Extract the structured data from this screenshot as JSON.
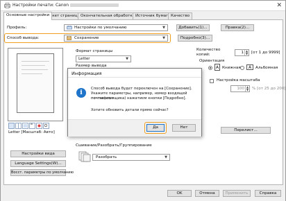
{
  "window": {
    "title": "Настройки печати: Canon",
    "close_glyph": "✕"
  },
  "tabs": [
    {
      "label": "Основные настройки",
      "active": true
    },
    {
      "label": "Макет страницы",
      "active": false
    },
    {
      "label": "Окончательная обработка",
      "active": false
    },
    {
      "label": "Источник бумаги",
      "active": false
    },
    {
      "label": "Качество",
      "active": false
    }
  ],
  "profile": {
    "label": "Профиль:",
    "value": "Настройки по умолчанию",
    "add_button": "Добавить(1)...",
    "edit_button": "Правка(2)..."
  },
  "output": {
    "label": "Способ вывода:",
    "value": "Сохранение",
    "details_button": "Подробно(3)...",
    "highlight_color": "#f0a020"
  },
  "page_format": {
    "label": "Формат страницы",
    "value": "Letter"
  },
  "output_size": {
    "label": "Размер вывода"
  },
  "copies": {
    "label_line1": "Количество",
    "label_line2": "копий:",
    "value": "1",
    "range": "[от 1 до 9999]"
  },
  "orientation": {
    "label": "Ориентация",
    "portrait_letter": "A",
    "portrait": "Книжная",
    "landscape_letter": "A",
    "landscape": "Альбомная"
  },
  "scaling": {
    "label": "Настройка масштаба",
    "value": "100",
    "range": "% [от 25 до 200]"
  },
  "preview": {
    "caption": "Letter [Масштаб: Авто]",
    "view_button": "Перелист..."
  },
  "collate": {
    "label": "Сшивание/Разобрать/Группирование",
    "value": "Разобрать"
  },
  "left_buttons": {
    "view_settings": "Настройки вида",
    "language": "Language Settings(W)...",
    "restore": "Восст. параметры по умолчанию"
  },
  "footer": {
    "ok": "OK",
    "cancel": "Отмена",
    "apply": "Применить",
    "help": "Справка"
  },
  "dialog": {
    "title": "Информация",
    "icon": "i",
    "message_line1": "Способ вывода будет переключен на [Сохранение].",
    "message_line2": "Укажите параметры, например, номер входящей почты (или",
    "message_line3": "почтового ящика) нажатием кнопки [Подробно].",
    "question": "Хотите обновить детали прямо сейчас?",
    "yes_button": "Да",
    "no_button": "Нет",
    "accent_color": "#1e74c8"
  }
}
